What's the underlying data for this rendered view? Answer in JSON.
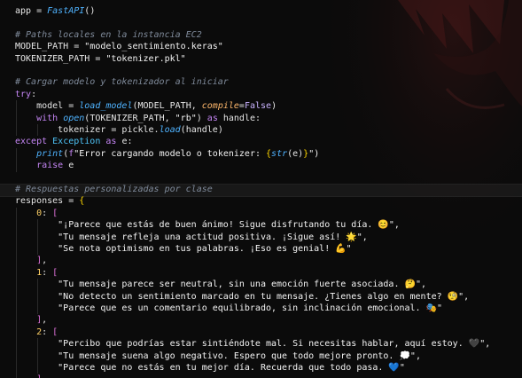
{
  "editor": {
    "language": "python",
    "colors": {
      "background": "#0b0b0b",
      "text": "#e6e6e6",
      "comment": "#7f8a9a",
      "function": "#4fb3ff",
      "keyword": "#c586f5",
      "exception": "#4fc3f7",
      "number": "#ffd166",
      "parameter": "#ffb86c",
      "constant": "#c9b3ff",
      "bracket_level_1": "#ffd700",
      "bracket_level_2": "#da70d6"
    },
    "current_line_index": 15,
    "lines": [
      [
        [
          "app ",
          "t-default"
        ],
        [
          "= ",
          "t-op"
        ],
        [
          "FastAPI",
          "t-func"
        ],
        [
          "()",
          "t-default"
        ]
      ],
      [],
      [
        [
          "# Paths locales en la instancia EC2",
          "t-comment"
        ]
      ],
      [
        [
          "MODEL_PATH ",
          "t-default"
        ],
        [
          "= ",
          "t-op"
        ],
        [
          "\"modelo_sentimiento.keras\"",
          "t-string"
        ]
      ],
      [
        [
          "TOKENIZER_PATH ",
          "t-default"
        ],
        [
          "= ",
          "t-op"
        ],
        [
          "\"tokenizer.pkl\"",
          "t-string"
        ]
      ],
      [],
      [
        [
          "# Cargar modelo y tokenizador al iniciar",
          "t-comment"
        ]
      ],
      [
        [
          "try",
          "t-kw"
        ],
        [
          ":",
          "t-default"
        ]
      ],
      [
        [
          "    model ",
          "t-default"
        ],
        [
          "= ",
          "t-op"
        ],
        [
          "load_model",
          "t-func"
        ],
        [
          "(MODEL_PATH, ",
          "t-default"
        ],
        [
          "compile",
          "t-param"
        ],
        [
          "=",
          "t-op"
        ],
        [
          "False",
          "t-const"
        ],
        [
          ")",
          "t-default"
        ]
      ],
      [
        [
          "    ",
          "t-default"
        ],
        [
          "with ",
          "t-kw"
        ],
        [
          "open",
          "t-func"
        ],
        [
          "(TOKENIZER_PATH, ",
          "t-default"
        ],
        [
          "\"rb\"",
          "t-string"
        ],
        [
          ") ",
          "t-default"
        ],
        [
          "as ",
          "t-kw"
        ],
        [
          "handle:",
          "t-default"
        ]
      ],
      [
        [
          "        tokenizer ",
          "t-default"
        ],
        [
          "= ",
          "t-op"
        ],
        [
          "pickle.",
          "t-default"
        ],
        [
          "load",
          "t-func"
        ],
        [
          "(handle)",
          "t-default"
        ]
      ],
      [
        [
          "except ",
          "t-kw"
        ],
        [
          "Exception ",
          "t-exc"
        ],
        [
          "as ",
          "t-kw"
        ],
        [
          "e:",
          "t-default"
        ]
      ],
      [
        [
          "    ",
          "t-default"
        ],
        [
          "print",
          "t-func"
        ],
        [
          "(",
          "t-default"
        ],
        [
          "f",
          "t-kw"
        ],
        [
          "\"Error cargando modelo o tokenizer: ",
          "t-string"
        ],
        [
          "{",
          "t-bracket1"
        ],
        [
          "str",
          "t-func"
        ],
        [
          "(e)",
          "t-default"
        ],
        [
          "}",
          "t-bracket1"
        ],
        [
          "\")",
          "t-string"
        ]
      ],
      [
        [
          "    ",
          "t-default"
        ],
        [
          "raise ",
          "t-kw"
        ],
        [
          "e",
          "t-default"
        ]
      ],
      [],
      [
        [
          "# Respuestas personalizadas por clase",
          "t-comment"
        ]
      ],
      [
        [
          "responses ",
          "t-default"
        ],
        [
          "= ",
          "t-op"
        ],
        [
          "{",
          "t-bracket1"
        ]
      ],
      [
        [
          "    ",
          "t-default"
        ],
        [
          "0",
          "t-num"
        ],
        [
          ": ",
          "t-default"
        ],
        [
          "[",
          "t-bracket2"
        ]
      ],
      [
        [
          "        \"¡Parece que estás de buen ánimo! Sigue disfrutando tu día. 😊\",",
          "t-string"
        ]
      ],
      [
        [
          "        \"Tu mensaje refleja una actitud positiva. ¡Sigue así! 🌟\",",
          "t-string"
        ]
      ],
      [
        [
          "        \"Se nota optimismo en tus palabras. ¡Eso es genial! 💪\"",
          "t-string"
        ]
      ],
      [
        [
          "    ",
          "t-default"
        ],
        [
          "]",
          "t-bracket2"
        ],
        [
          ",",
          "t-default"
        ]
      ],
      [
        [
          "    ",
          "t-default"
        ],
        [
          "1",
          "t-num"
        ],
        [
          ": ",
          "t-default"
        ],
        [
          "[",
          "t-bracket2"
        ]
      ],
      [
        [
          "        \"Tu mensaje parece ser neutral, sin una emoción fuerte asociada. 🤔\",",
          "t-string"
        ]
      ],
      [
        [
          "        \"No detecto un sentimiento marcado en tu mensaje. ¿Tienes algo en mente? 🧐\",",
          "t-string"
        ]
      ],
      [
        [
          "        \"Parece que es un comentario equilibrado, sin inclinación emocional. 🎭\"",
          "t-string"
        ]
      ],
      [
        [
          "    ",
          "t-default"
        ],
        [
          "]",
          "t-bracket2"
        ],
        [
          ",",
          "t-default"
        ]
      ],
      [
        [
          "    ",
          "t-default"
        ],
        [
          "2",
          "t-num"
        ],
        [
          ": ",
          "t-default"
        ],
        [
          "[",
          "t-bracket2"
        ]
      ],
      [
        [
          "        \"Percibo que podrías estar sintiéndote mal. Si necesitas hablar, aquí estoy. 🖤\",",
          "t-string"
        ]
      ],
      [
        [
          "        \"Tu mensaje suena algo negativo. Espero que todo mejore pronto. 💭\",",
          "t-string"
        ]
      ],
      [
        [
          "        \"Parece que no estás en tu mejor día. Recuerda que todo pasa. 💙\"",
          "t-string"
        ]
      ],
      [
        [
          "    ",
          "t-default"
        ],
        [
          "]",
          "t-bracket2"
        ]
      ]
    ]
  }
}
